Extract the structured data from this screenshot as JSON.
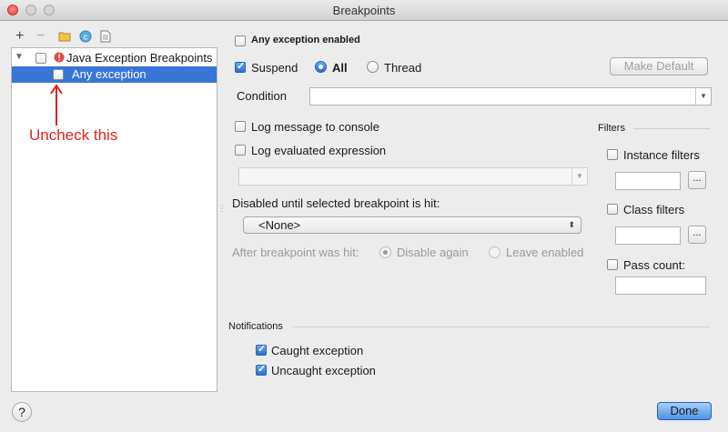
{
  "window": {
    "title": "Breakpoints"
  },
  "toolbar": {
    "add": "+",
    "remove": "−"
  },
  "tree": {
    "group_label": "Java Exception Breakpoints",
    "item_label": "Any exception"
  },
  "annotation": {
    "text": "Uncheck this",
    "color": "#e3221b"
  },
  "details": {
    "any_exception_enabled": "Any exception enabled",
    "suspend": "Suspend",
    "suspend_all": "All",
    "suspend_thread": "Thread",
    "make_default": "Make Default",
    "condition_label": "Condition",
    "log_message": "Log message to console",
    "log_expression": "Log evaluated expression",
    "disabled_until": "Disabled until selected breakpoint is hit:",
    "none_option": "<None>",
    "after_hit": "After breakpoint was hit:",
    "disable_again": "Disable again",
    "leave_enabled": "Leave enabled"
  },
  "filters": {
    "title": "Filters",
    "instance": "Instance filters",
    "class": "Class filters",
    "pass_count": "Pass count:",
    "browse": "..."
  },
  "notifications": {
    "title": "Notifications",
    "caught": "Caught exception",
    "uncaught": "Uncaught exception"
  },
  "footer": {
    "help": "?",
    "done": "Done"
  },
  "colors": {
    "selection": "#3875d7",
    "accent": "#2b6ed6"
  }
}
